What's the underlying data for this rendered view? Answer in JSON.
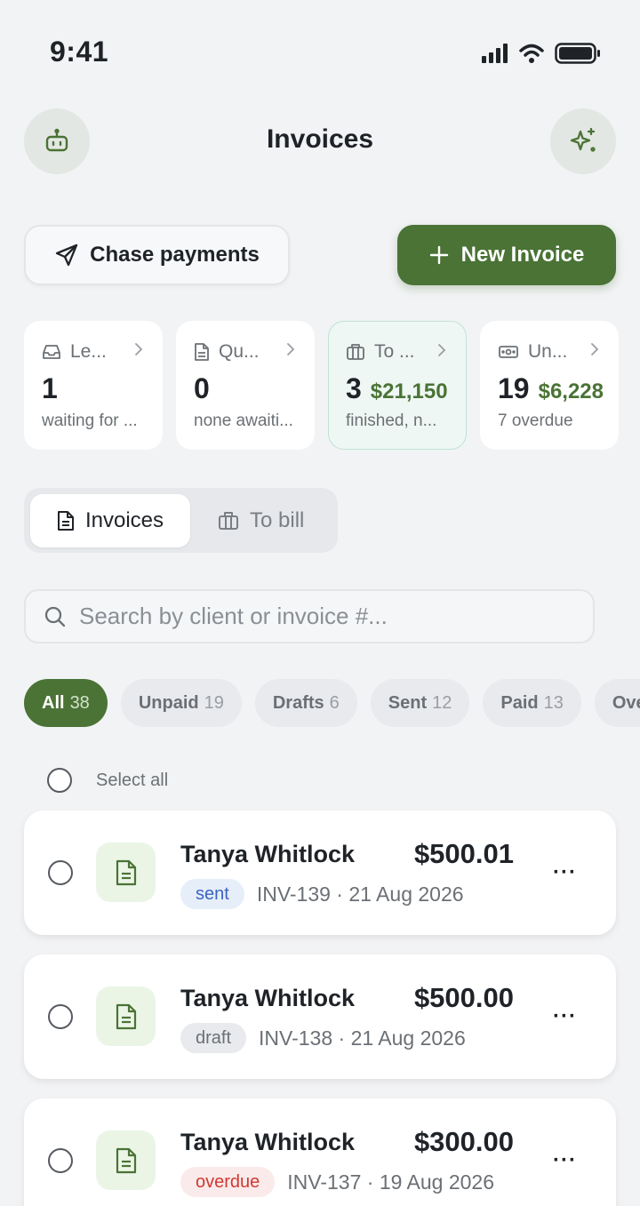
{
  "status_bar": {
    "time": "9:41"
  },
  "header": {
    "title": "Invoices",
    "left_icon": "robot-icon",
    "right_icon": "sparkle-icon"
  },
  "actions": {
    "chase_label": "Chase payments",
    "new_label": "New Invoice"
  },
  "summary_cards": [
    {
      "icon": "inbox-icon",
      "label": "Le...",
      "count": "1",
      "amount": "",
      "sub": "waiting for ..."
    },
    {
      "icon": "document-icon",
      "label": "Qu...",
      "count": "0",
      "amount": "",
      "sub": "none awaiti..."
    },
    {
      "icon": "briefcase-icon",
      "label": "To ...",
      "count": "3",
      "amount": "$21,150",
      "sub": "finished, n..."
    },
    {
      "icon": "cash-icon",
      "label": "Un...",
      "count": "19",
      "amount": "$6,228",
      "sub": "7 overdue"
    }
  ],
  "segment": {
    "invoices_label": "Invoices",
    "tobill_label": "To bill"
  },
  "search": {
    "placeholder": "Search by client or invoice #..."
  },
  "filters": [
    {
      "label": "All",
      "count": "38",
      "active": true
    },
    {
      "label": "Unpaid",
      "count": "19"
    },
    {
      "label": "Drafts",
      "count": "6"
    },
    {
      "label": "Sent",
      "count": "12"
    },
    {
      "label": "Paid",
      "count": "13"
    },
    {
      "label": "Ove",
      "count": ""
    }
  ],
  "select_all_label": "Select all",
  "invoices": [
    {
      "client": "Tanya Whitlock",
      "amount": "$500.01",
      "status": "sent",
      "meta": "INV-139 · 21 Aug 2026"
    },
    {
      "client": "Tanya Whitlock",
      "amount": "$500.00",
      "status": "draft",
      "meta": "INV-138 · 21 Aug 2026"
    },
    {
      "client": "Tanya Whitlock",
      "amount": "$300.00",
      "status": "overdue",
      "meta": "INV-137 · 19 Aug 2026"
    }
  ],
  "more_label": "···",
  "colors": {
    "accent": "#4a7335",
    "background": "#f2f3f5",
    "sent": "#3a64c0",
    "overdue": "#cf3a32"
  }
}
